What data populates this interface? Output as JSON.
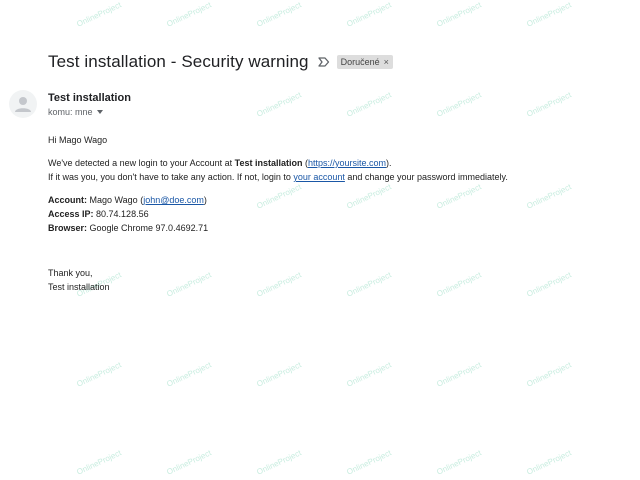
{
  "subject": "Test installation - Security warning",
  "label": "Doručené",
  "label_close": "×",
  "sender_name": "Test installation",
  "recipient_line": "komu: mne",
  "greeting": "Hi Mago Wago",
  "para1_prefix": "We've detected a new login to your Account at ",
  "para1_bold": "Test installation",
  "para1_open": " (",
  "para1_link": "https://yoursite.com",
  "para1_close": ").",
  "para2_prefix": "If it was you, you don't have to take any action. If not, login to ",
  "para2_link": "your account",
  "para2_suffix": " and change your password immediately.",
  "account_label": "Account:",
  "account_name": " Mago Wago (",
  "account_email": "john@doe.com",
  "account_close": ")",
  "ip_label": "Access IP:",
  "ip_value": " 80.74.128.56",
  "browser_label": "Browser:",
  "browser_value": " Google Chrome 97.0.4692.71",
  "thanks": "Thank you,",
  "signature": "Test installation",
  "watermark": "OnlineProject",
  "colors": {
    "link": "#1a57a6",
    "chip_bg": "#dddddd",
    "watermark": "#c9ede0"
  },
  "icons": {
    "importance": "importance-marker-icon",
    "avatar": "person-avatar-icon",
    "dropdown": "caret-down-icon"
  }
}
